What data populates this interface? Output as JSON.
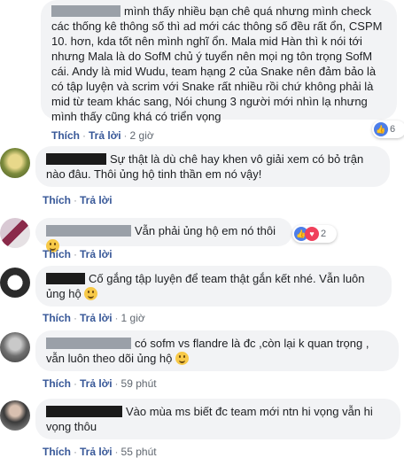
{
  "actions": {
    "like": "Thích",
    "reply": "Trả lời"
  },
  "comments": [
    {
      "text": "mình thấy nhiều bạn chê quá nhưng mình check các thống kê thông số thì ad mới các thông số đều rất ổn, CSPM 10. hơn, kda tốt nên mình nghĩ ổn. Mala mid Hàn thì k nói tới nhưng Mala là do SofM chủ ý tuyển nên mọi ng tôn trọng SofM cái. Andy là mid Wudu, team hạng 2 của Snake nên đảm bảo là có tập luyện và scrim với Snake rất nhiều rồi chứ không phải là mid từ team khác sang, Nói chung 3 người mới nhìn lạ nhưng mình thấy cũng khá có triển vọng",
      "time": "2 giờ",
      "reaction_count": "6"
    },
    {
      "text": "Sự thật là dù chê hay khen vô giải xem có bỏ trận nào đâu. Thôi ủng hộ tinh thần em nó vậy!",
      "time": "",
      "reaction_count": ""
    },
    {
      "text": "Vẫn phải ủng hộ em nó thôi",
      "time": "",
      "reaction_count": "2"
    },
    {
      "text": "Cố gắng tập luyện để team thật gắn kết nhé. Vẫn luôn ủng hộ",
      "time": "1 giờ",
      "reaction_count": ""
    },
    {
      "text": "có sofm vs flandre là đc ,còn lại k quan trọng , vẫn luôn theo dõi ủng hộ",
      "time": "59 phút",
      "reaction_count": ""
    },
    {
      "text": "Vào mùa ms biết đc team mới ntn hi vọng vẫn hi vọng thôu",
      "time": "55 phút",
      "reaction_count": ""
    }
  ]
}
